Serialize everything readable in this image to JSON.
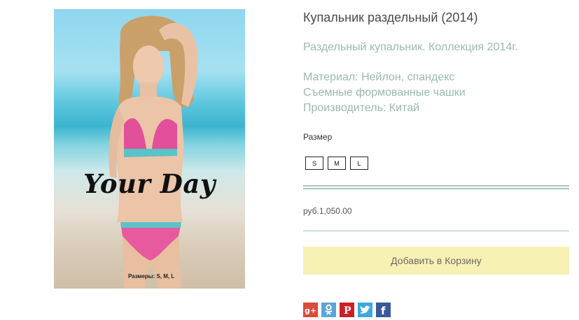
{
  "product": {
    "title": "Купальник раздельный (2014)",
    "description": "Раздельный купальник. Коллекция 2014г.",
    "material": "Материал: Нейлон, спандекс",
    "cups": "Съемные формованные чашки",
    "producer": "Производитель: Китай",
    "price": "руб.1,050.00"
  },
  "image": {
    "brand_text": "Your Day",
    "sizes_caption": "Размеры: S, M, L"
  },
  "size_selector": {
    "label": "Размер",
    "options": [
      "S",
      "M",
      "L"
    ]
  },
  "cart": {
    "add_label": "Добавить в Корзину"
  },
  "social": [
    {
      "name": "google-plus-icon",
      "color": "#dd4b39",
      "glyph": "g+"
    },
    {
      "name": "odnoklassniki-icon",
      "color": "#5aa6d8",
      "glyph": "ok"
    },
    {
      "name": "pinterest-icon",
      "color": "#cb2027",
      "glyph": "P"
    },
    {
      "name": "twitter-icon",
      "color": "#3ba9e0",
      "glyph": "t"
    },
    {
      "name": "facebook-icon",
      "color": "#3b5998",
      "glyph": "f"
    }
  ]
}
